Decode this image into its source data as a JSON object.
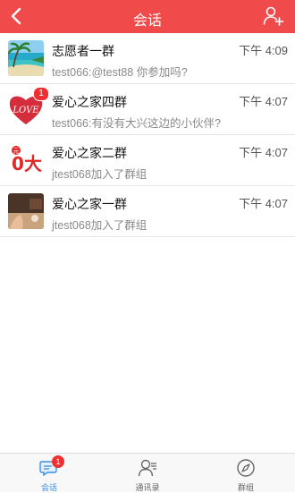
{
  "header": {
    "title": "会话",
    "bg_color": "#f04a4a"
  },
  "conversations": [
    {
      "name": "志愿者一群",
      "time": "下午 4:09",
      "message": "test066:@test88 你参加吗?",
      "badge": ""
    },
    {
      "name": "爱心之家四群",
      "time": "下午 4:07",
      "message": "test066:有没有大兴这边的小伙伴?",
      "badge": "1"
    },
    {
      "name": "爱心之家二群",
      "time": "下午 4:07",
      "message": "jtest068加入了群组",
      "badge": ""
    },
    {
      "name": "爱心之家一群",
      "time": "下午 4:07",
      "message": "jtest068加入了群组",
      "badge": ""
    }
  ],
  "avatars": {
    "a0_text": "",
    "a1_text": "LOVE",
    "a2_small": "元",
    "a2_text": "0大",
    "a3_text": ""
  },
  "tabs": [
    {
      "label": "会话",
      "badge": "1",
      "icon": "chat-icon"
    },
    {
      "label": "通讯录",
      "icon": "contacts-icon"
    },
    {
      "label": "群组",
      "icon": "compass-icon"
    }
  ],
  "colors": {
    "accent": "#f04a4a",
    "tab_active": "#3a8ee6",
    "badge": "#f03030"
  }
}
